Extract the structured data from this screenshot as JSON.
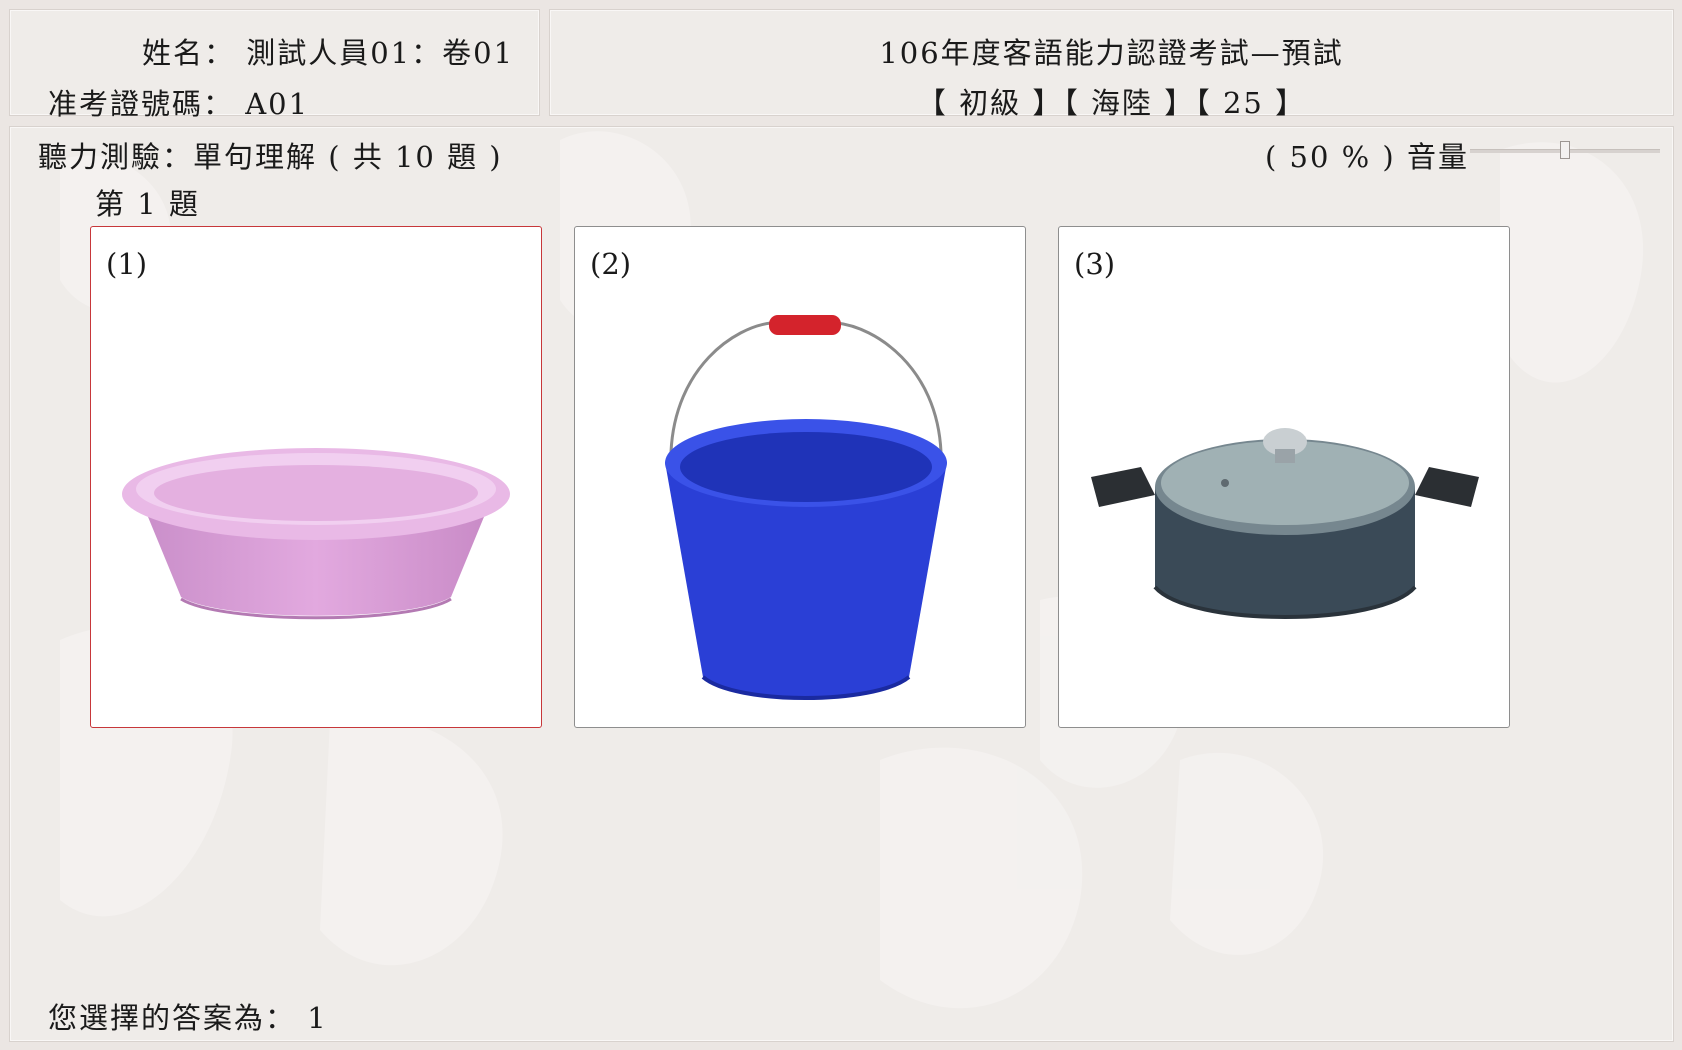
{
  "header": {
    "name_label": "姓名：",
    "name_value": "測試人員01：卷01",
    "id_label": "准考證號碼：",
    "id_value": "A01",
    "exam_title": "106年度客語能力認證考試—預試",
    "exam_tags": "【 初級 】【 海陸 】【 25 】"
  },
  "section": {
    "title": "聽力測驗：單句理解 ( 共 10 題 )",
    "question_label": "第 1 題"
  },
  "volume": {
    "label": "( 50 % ) 音量",
    "percent": 50
  },
  "options": [
    {
      "label": "(1)",
      "icon": "pink-basin-icon",
      "selected": true
    },
    {
      "label": "(2)",
      "icon": "blue-bucket-icon",
      "selected": false
    },
    {
      "label": "(3)",
      "icon": "cooking-pot-icon",
      "selected": false
    }
  ],
  "answer": {
    "label": "您選擇的答案為：",
    "value": "1"
  },
  "colors": {
    "background": "#ebe6e3",
    "selected_border": "#c7373a",
    "card_border": "#8e8e8e"
  }
}
